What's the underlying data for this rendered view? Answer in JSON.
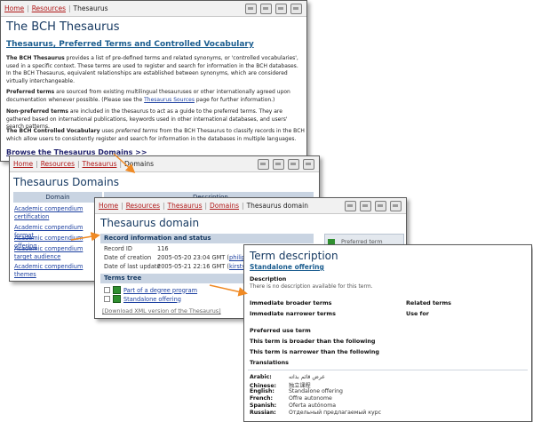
{
  "window1": {
    "breadcrumb": [
      "Home",
      "Resources",
      "Thesaurus"
    ],
    "title": "The BCH Thesaurus",
    "subtitle": "Thesaurus, Preferred Terms and Controlled Vocabulary",
    "p1_bold": "The BCH Thesaurus",
    "p1_rest": " provides a list of pre-defined terms and related synonyms, or 'controlled vocabularies', used in a specific context. These terms are used to register and search for information in the BCH databases. In the BCH Thesaurus, equivalent relationships are established between synonyms, which are considered virtually interchangeable.",
    "p2_bold": "Preferred terms",
    "p2_rest": " are sourced from existing multilingual thesauruses or other internationally agreed upon documentation whenever possible. (Please see the ",
    "p2_link": "Thesaurus Sources",
    "p2_end": " page for further information.)",
    "p3_bold": "Non-preferred terms",
    "p3_rest": " are included in the thesaurus to act as a guide to the preferred terms. They are gathered based on international publications, keywords used in other international databases, and users' search patterns.",
    "p4_bold": "The BCH Controlled Vocabulary",
    "p4_mid": " uses ",
    "p4_em": "preferred terms",
    "p4_rest": " from the BCH Thesaurus to classify records in the BCH which allow users to consistently register and search for information in the databases in multiple languages.",
    "browse_link": "Browse the Thesaurus Domains >>"
  },
  "window2": {
    "breadcrumb": [
      "Home",
      "Resources",
      "Thesaurus",
      "Domains"
    ],
    "title": "Thesaurus Domains",
    "col_domain": "Domain",
    "col_description": "Description",
    "domains": [
      "Academic compendium certification",
      "Academic compendium format",
      "Academic compendium offering",
      "Academic compendium target audience",
      "Academic compendium themes"
    ]
  },
  "window3": {
    "breadcrumb": [
      "Home",
      "Resources",
      "Thesaurus",
      "Domains",
      "Thesaurus domain"
    ],
    "title": "Thesaurus domain",
    "section_record": "Record information and status",
    "record_id_label": "Record ID",
    "record_id_value": "116",
    "created_label": "Date of creation",
    "created_value": "2005-05-20 23:04 GMT (",
    "created_user": "philippe.lebl",
    "updated_label": "Date of last update",
    "updated_value": "2005-05-21 22:16 GMT (",
    "updated_user": "kirsty.mclea",
    "section_tree": "Terms tree",
    "tree_items": [
      "Part of a degree program",
      "Standalone offering"
    ],
    "download_xml": "[Download XML version of the Thesaurus]",
    "preferred_term": "Preferred term"
  },
  "window4": {
    "title": "Term description",
    "term": "Standalone offering",
    "description_label": "Description",
    "description_text": "There is no description available for this term.",
    "broader_label": "Immediate broader terms",
    "related_label": "Related terms",
    "narrower_label": "Immediate narrower terms",
    "usefor_label": "Use for",
    "preferred_use_label": "Preferred use term",
    "broader_than_label": "This term is broader than the following",
    "narrower_than_label": "This term is narrower than the following",
    "translations_label": "Translations",
    "translations": [
      {
        "lang": "Arabic:",
        "value": "عرض قائم بذاته"
      },
      {
        "lang": "Chinese:",
        "value": "独立课程"
      },
      {
        "lang": "English:",
        "value": "Standalone offering"
      },
      {
        "lang": "French:",
        "value": "Offre autonome"
      },
      {
        "lang": "Spanish:",
        "value": "Oferta autónoma"
      },
      {
        "lang": "Russian:",
        "value": "Отдельный предлагаемый курс"
      }
    ]
  },
  "colors": {
    "arrow": "#f08a24",
    "crumb_link": "#b01818",
    "title": "#173a62",
    "header_bg": "#c9d4e2"
  }
}
